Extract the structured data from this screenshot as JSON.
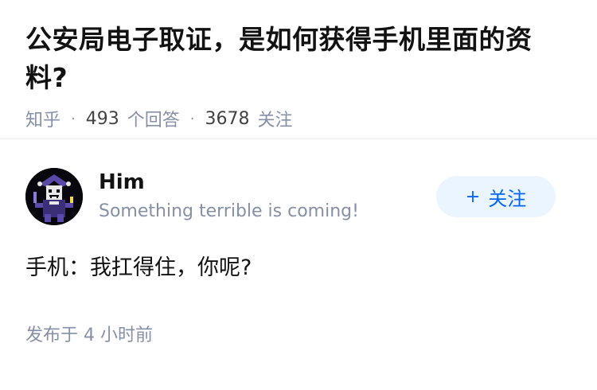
{
  "question": {
    "title": "公安局电子取证，是如何获得手机里面的资料?",
    "source": "知乎",
    "answer_count": "493",
    "answer_label": "个回答",
    "follower_count": "3678",
    "follower_label": "关注"
  },
  "answer": {
    "author_name": "Him",
    "author_bio": "Something terrible is coming!",
    "follow_plus": "+",
    "follow_label": "关注",
    "content": "手机：我扛得住，你呢?",
    "published": "发布于 4 小时前"
  },
  "colors": {
    "meta_gray": "#8590a6",
    "follow_blue": "#0066ff",
    "follow_bg": "#ebf5ff",
    "avatar_bg": "#07070d"
  },
  "icons": {
    "avatar": "jester-avatar-icon"
  }
}
